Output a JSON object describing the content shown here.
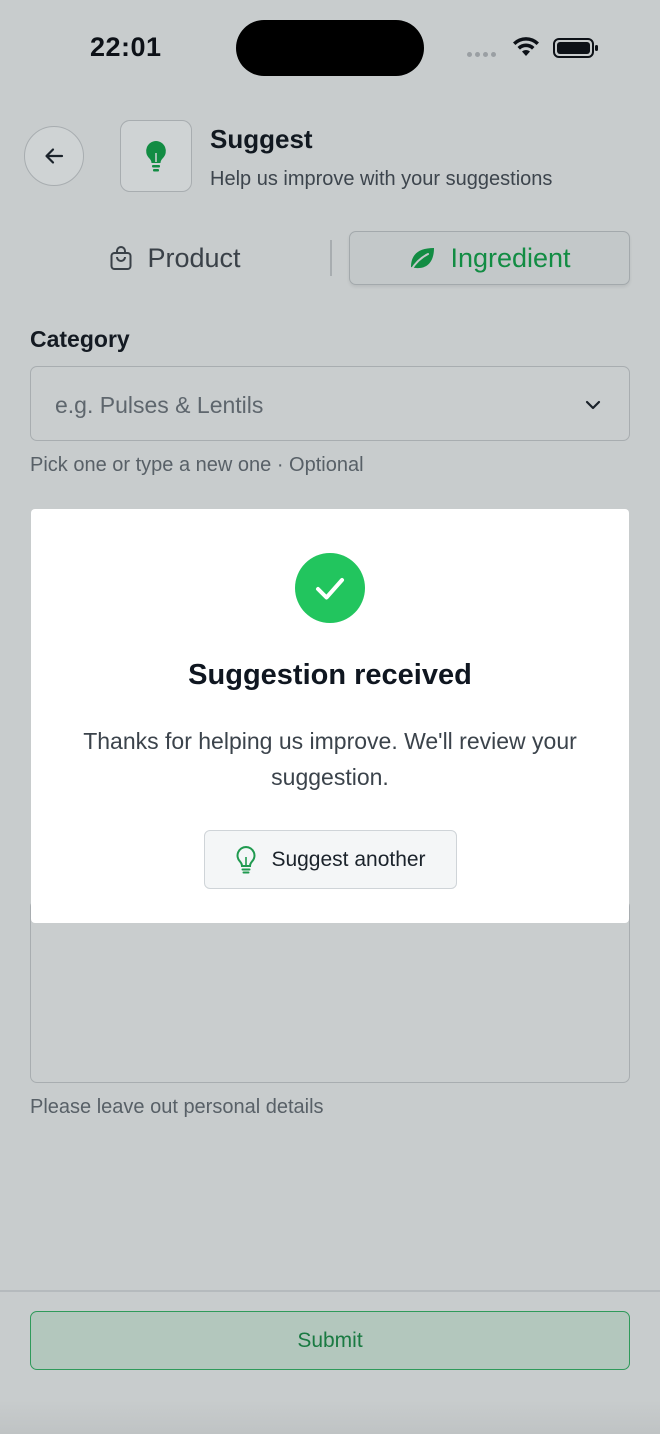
{
  "status_bar": {
    "time": "22:01"
  },
  "header": {
    "title": "Suggest",
    "subtitle": "Help us improve with your suggestions",
    "back_icon": "arrow-left-icon",
    "app_icon": "lightbulb-icon"
  },
  "tabs": [
    {
      "label": "Product",
      "icon": "shopping-bag-icon",
      "selected": false
    },
    {
      "label": "Ingredient",
      "icon": "leaf-icon",
      "selected": true
    }
  ],
  "form": {
    "category_label": "Category",
    "category_placeholder": "e.g. Pulses & Lentils",
    "category_help": "Pick one or type a new one · Optional",
    "privacy_note": "Please leave out personal details"
  },
  "modal": {
    "title": "Suggestion received",
    "message": "Thanks for helping us improve. We'll review your suggestion.",
    "button_label": "Suggest another",
    "button_icon": "lightbulb-icon"
  },
  "footer": {
    "submit_label": "Submit"
  },
  "colors": {
    "accent_green": "#128c43",
    "success_green": "#22c55e",
    "overlay_bg": "#c8cccd"
  }
}
